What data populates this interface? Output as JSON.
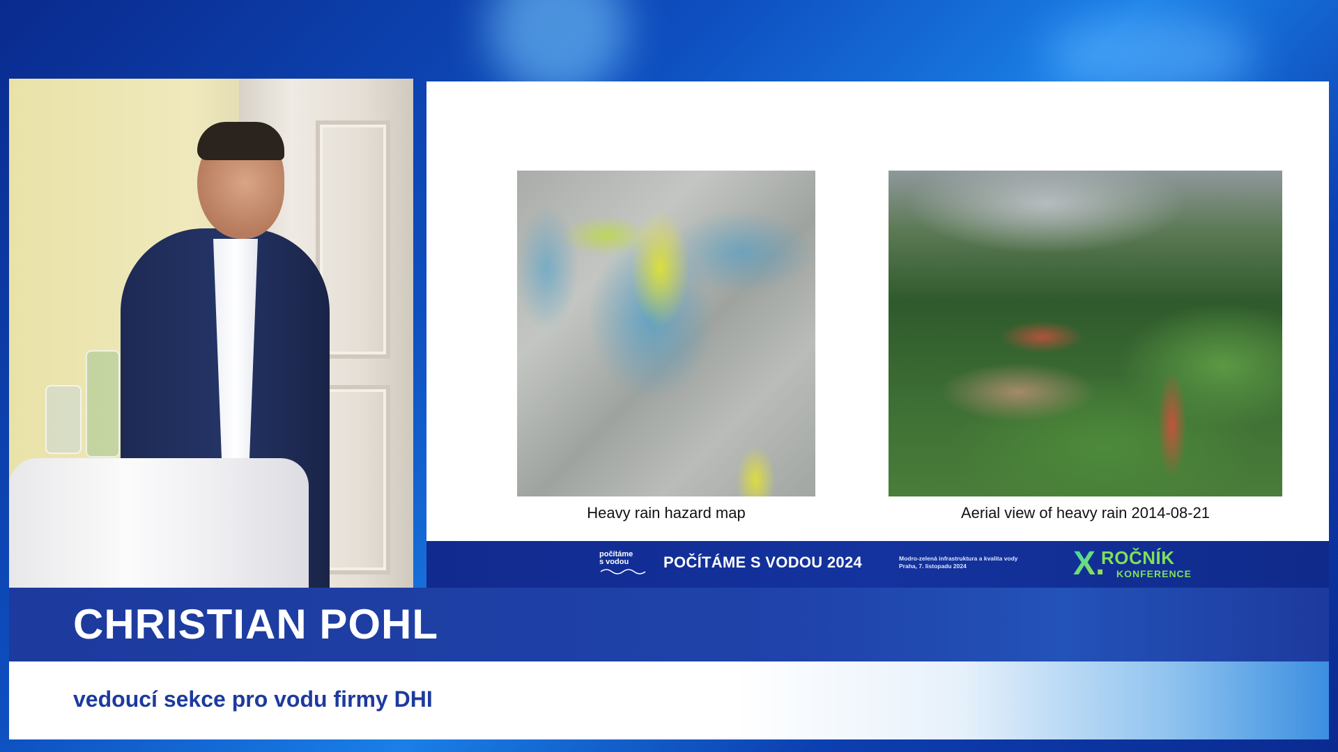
{
  "slide": {
    "images": [
      {
        "caption": "Heavy rain hazard map"
      },
      {
        "caption": "Aerial view of heavy rain 2014-08-21"
      }
    ]
  },
  "conference": {
    "logo_line1": "počítáme",
    "logo_line2": "s vodou",
    "title": "POČÍTÁME S VODOU 2024",
    "subtitle_line1": "Modro-zelená infrastruktura a kvalita vody",
    "subtitle_line2": "Praha, 7. listopadu 2024",
    "badge_numeral": "X.",
    "badge_word": "ROČNÍK",
    "badge_sub": "KONFERENCE"
  },
  "speaker": {
    "name": "CHRISTIAN POHL",
    "role": "vedoucí sekce pro vodu firmy DHI"
  },
  "colors": {
    "background": "#0e4fc0",
    "lower_third_name": "#1d3a9e",
    "role_text": "#1d3a9e",
    "badge_green": "#7fe05a"
  }
}
